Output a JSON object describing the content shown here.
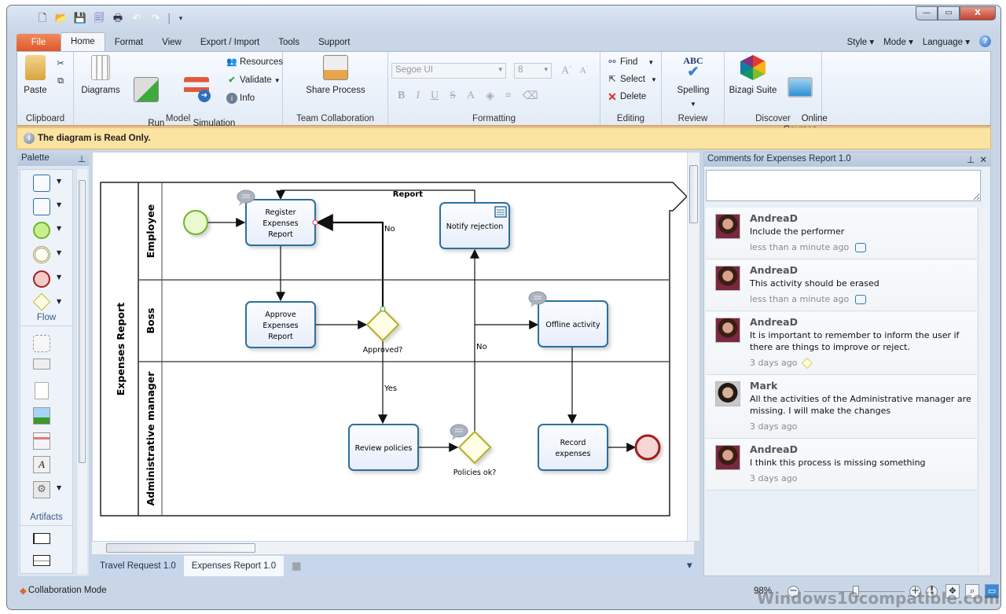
{
  "window": {
    "qat_icons": [
      "new-icon",
      "open-icon",
      "save-icon",
      "save-all-icon",
      "print-icon",
      "undo-icon",
      "redo-icon",
      "customize-icon"
    ],
    "controls": {
      "minimize": "—",
      "maximize": "▭",
      "close": "X"
    }
  },
  "menu": {
    "tabs": [
      {
        "label": "File",
        "active": false
      },
      {
        "label": "Home",
        "active": true
      },
      {
        "label": "Format",
        "active": false
      },
      {
        "label": "View",
        "active": false
      },
      {
        "label": "Export / Import",
        "active": false
      },
      {
        "label": "Tools",
        "active": false
      },
      {
        "label": "Support",
        "active": false
      }
    ],
    "right": [
      "Style ▾",
      "Mode ▾",
      "Language ▾"
    ]
  },
  "ribbon": {
    "clipboard": {
      "label": "Clipboard",
      "paste": "Paste"
    },
    "model": {
      "label": "Model",
      "diagrams": "Diagrams",
      "run": "Run\nWorkflow",
      "simulation": "Simulation\nView",
      "resources": "Resources",
      "validate": "Validate",
      "info": "Info"
    },
    "team": {
      "label": "Team Collaboration",
      "share": "Share Process"
    },
    "formatting": {
      "label": "Formatting",
      "font": "Segoe UI",
      "size": "8",
      "buttons": [
        "B",
        "I",
        "U",
        "S",
        "A",
        "◈",
        "≡",
        "⌫"
      ]
    },
    "editing": {
      "label": "Editing",
      "find": "Find",
      "select": "Select",
      "delete": "Delete"
    },
    "review": {
      "label": "Review",
      "spelling": "Spelling"
    },
    "discover": {
      "label": "Discover",
      "suite": "Bizagi Suite",
      "courses": "Online\nCourses"
    }
  },
  "infobar": {
    "message": "The diagram is Read Only."
  },
  "palette": {
    "title": "Palette",
    "sections": [
      "Flow",
      "Artifacts"
    ]
  },
  "diagram": {
    "pool": "Expenses Report",
    "lanes": [
      "Employee",
      "Boss",
      "Administrative manager"
    ],
    "tasks": {
      "register": [
        "Register",
        "Expenses",
        "Report"
      ],
      "approve": [
        "Approve",
        "Expenses",
        "Report"
      ],
      "notify": [
        "Notify rejection"
      ],
      "offline": [
        "Offline activity"
      ],
      "review": [
        "Review policies"
      ],
      "record": [
        "Record",
        "expenses"
      ]
    },
    "gateways": {
      "approved": "Approved?",
      "policies": "Policies ok?"
    },
    "flows": {
      "report": "Report",
      "no1": "No",
      "no2": "No",
      "yes": "Yes"
    }
  },
  "doctabs": [
    {
      "label": "Travel Request 1.0",
      "active": false
    },
    {
      "label": "Expenses Report 1.0",
      "active": true
    }
  ],
  "comments": {
    "title": "Comments for Expenses Report 1.0",
    "input_value": "",
    "items": [
      {
        "author": "AndreaD",
        "text": "Include the performer",
        "time": "less than a minute ago",
        "tag": "task",
        "avatar": "f"
      },
      {
        "author": "AndreaD",
        "text": "This activity should be erased",
        "time": "less than a minute ago",
        "tag": "task",
        "avatar": "f"
      },
      {
        "author": "AndreaD",
        "text": "It is important to remember to inform the user if there are things to improve or reject.",
        "time": "3 days ago",
        "tag": "gateway",
        "avatar": "f"
      },
      {
        "author": "Mark",
        "text": "All the activities of the Administrative manager are missing. I will make the changes",
        "time": "3 days ago",
        "tag": "",
        "avatar": "m"
      },
      {
        "author": "AndreaD",
        "text": "I think this process is missing something",
        "time": "3 days ago",
        "tag": "",
        "avatar": "f"
      }
    ]
  },
  "status": {
    "mode": "Collaboration Mode",
    "zoom": "98%",
    "watermark": "Windows10compatible.com"
  },
  "colors": {
    "file_tab": "#e0572a",
    "infobar": "#fbe3a2",
    "task_border": "#2a6f9e",
    "start": "#7cbf2e",
    "end": "#a51e1e",
    "gateway": "#b5ad2a"
  }
}
